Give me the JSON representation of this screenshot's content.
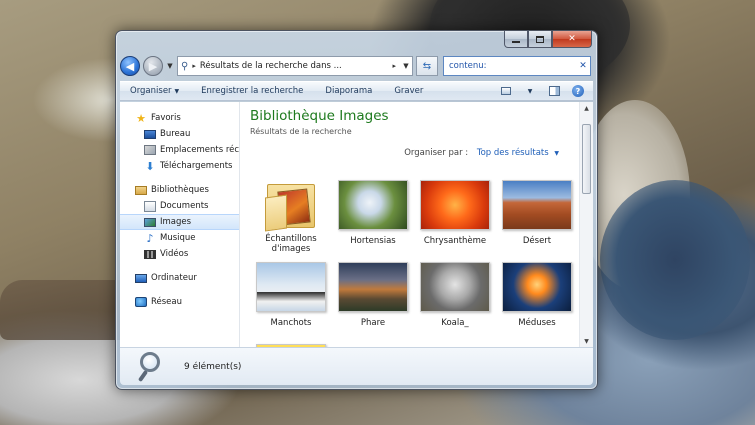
{
  "window": {
    "search_value": "contenu:"
  },
  "address": {
    "path": "Résultats de la recherche dans ..."
  },
  "toolbar": {
    "organize": "Organiser",
    "save_search": "Enregistrer la recherche",
    "slideshow": "Diaporama",
    "burn": "Graver"
  },
  "nav_pane": {
    "favorites": "Favoris",
    "desktop": "Bureau",
    "recent_places": "Emplacements récents",
    "downloads": "Téléchargements",
    "libraries": "Bibliothèques",
    "documents": "Documents",
    "images": "Images",
    "music": "Musique",
    "videos": "Vidéos",
    "computer": "Ordinateur",
    "network": "Réseau"
  },
  "content": {
    "library_title": "Bibliothèque Images",
    "library_subtitle": "Résultats de la recherche",
    "arrange_label": "Organiser par :",
    "arrange_value": "Top des résultats",
    "items": [
      {
        "label": "Échantillons d'images"
      },
      {
        "label": "Hortensias"
      },
      {
        "label": "Chrysanthème"
      },
      {
        "label": "Désert"
      },
      {
        "label": "Manchots"
      },
      {
        "label": "Phare"
      },
      {
        "label": "Koala_"
      },
      {
        "label": "Méduses"
      },
      {
        "label": ""
      }
    ]
  },
  "details": {
    "count": "9 élément(s)"
  },
  "icons": {
    "back": "back-arrow-icon",
    "forward": "forward-arrow-icon",
    "refresh": "refresh-icon",
    "search_clear": "close-icon",
    "help": "help-icon"
  },
  "colors": {
    "library_title": "#1e7a1e",
    "arrange_value": "#1f5fb8",
    "close_button": "#c0391e"
  }
}
